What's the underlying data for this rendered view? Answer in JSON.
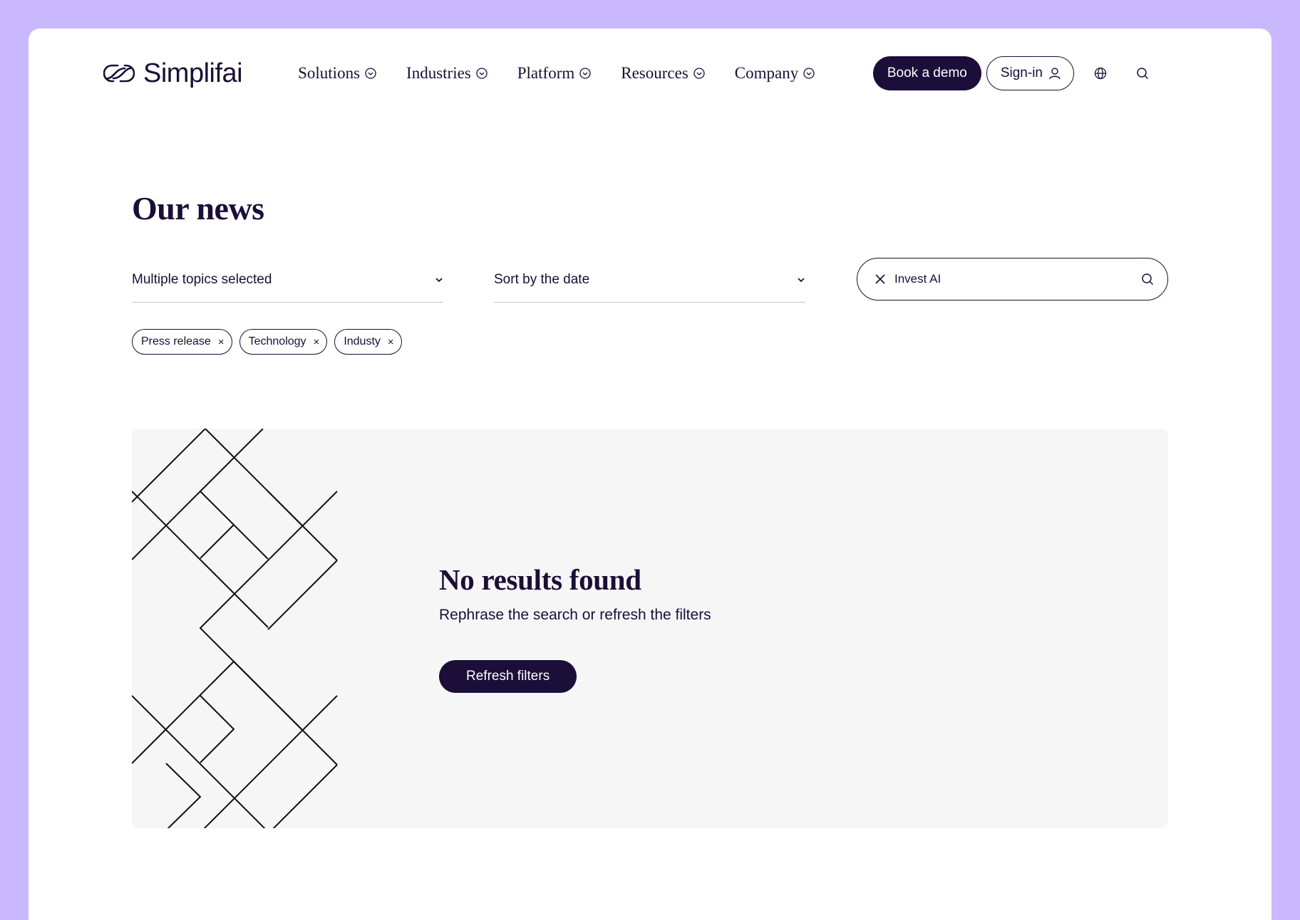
{
  "brand": {
    "name": "Simplifai"
  },
  "nav": {
    "items": [
      {
        "label": "Solutions"
      },
      {
        "label": "Industries"
      },
      {
        "label": "Platform"
      },
      {
        "label": "Resources"
      },
      {
        "label": "Company"
      }
    ],
    "demo_label": "Book a demo",
    "signin_label": "Sign-in"
  },
  "page": {
    "title": "Our news"
  },
  "filters": {
    "topics_value": "Multiple topics selected",
    "sort_value": "Sort by the date",
    "search_value": "Invest AI",
    "tags": [
      {
        "label": "Press release"
      },
      {
        "label": "Technology"
      },
      {
        "label": "Industy"
      }
    ]
  },
  "empty_state": {
    "title": "No results found",
    "subtitle": "Rephrase the search or refresh the filters",
    "button_label": "Refresh filters"
  },
  "colors": {
    "background": "#c9b8fd",
    "primary": "#1b0f3a",
    "panel": "#f6f6f6"
  }
}
